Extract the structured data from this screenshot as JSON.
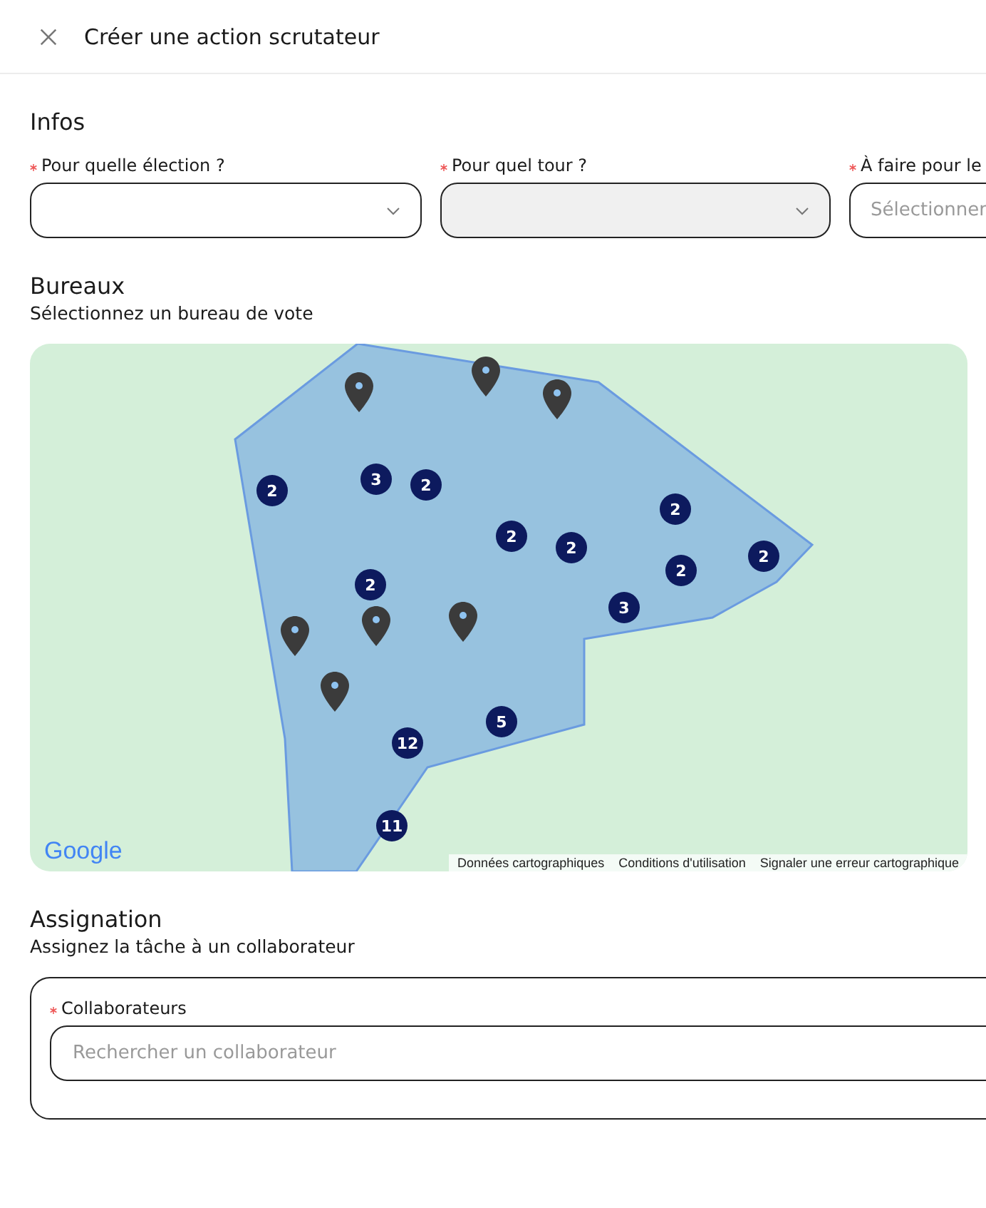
{
  "header": {
    "title": "Créer une action scrutateur"
  },
  "infos": {
    "title": "Infos",
    "fields": [
      {
        "label": "Pour quelle élection ?",
        "required": true,
        "disabled": false,
        "kind": "select"
      },
      {
        "label": "Pour quel tour ?",
        "required": true,
        "disabled": true,
        "kind": "select"
      },
      {
        "label": "À faire pour le",
        "required": true,
        "disabled": false,
        "kind": "date",
        "placeholder": "Sélectionner"
      }
    ]
  },
  "bureaux": {
    "title": "Bureaux",
    "subtitle": "Sélectionnez un bureau de vote",
    "map": {
      "logo": "Google",
      "clusters": [
        "2",
        "3",
        "2",
        "2",
        "2",
        "2",
        "2",
        "2",
        "2",
        "3",
        "5",
        "12",
        "11"
      ],
      "attribution": [
        "Données cartographiques",
        "Conditions d'utilisation",
        "Signaler une erreur cartographique"
      ]
    }
  },
  "assignation": {
    "title": "Assignation",
    "subtitle": "Assignez la tâche à un collaborateur",
    "field": {
      "label": "Collaborateurs",
      "required": true,
      "placeholder": "Rechercher un collaborateur"
    }
  }
}
